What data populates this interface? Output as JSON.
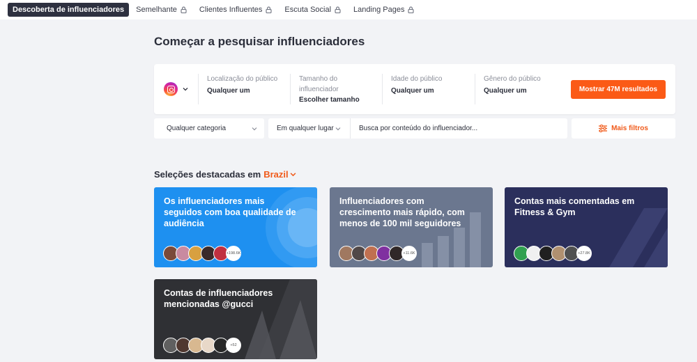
{
  "nav": {
    "tabs": [
      {
        "label": "Descoberta de influenciadores",
        "locked": false,
        "active": true
      },
      {
        "label": "Semelhante",
        "locked": true,
        "active": false
      },
      {
        "label": "Clientes Influentes",
        "locked": true,
        "active": false
      },
      {
        "label": "Escuta Social",
        "locked": true,
        "active": false
      },
      {
        "label": "Landing Pages",
        "locked": true,
        "active": false
      }
    ]
  },
  "page_title": "Começar a pesquisar influenciadores",
  "filters": {
    "platform_icon": "instagram-icon",
    "location": {
      "label": "Localização do público",
      "value": "Qualquer um"
    },
    "size": {
      "label_line1": "Tamanho do",
      "label_line2": "influenciador",
      "value": "Escolher tamanho"
    },
    "age": {
      "label": "Idade do público",
      "value": "Qualquer um"
    },
    "gender": {
      "label": "Gênero do público",
      "value": "Qualquer um"
    },
    "show_button": "Mostrar 47M resultados"
  },
  "search": {
    "category": "Qualquer categoria",
    "place": "Em qualquer lugar",
    "content_placeholder": "Busca por conteúdo do influenciador...",
    "more_filters": "Mais filtros"
  },
  "featured": {
    "title": "Seleções destacadas em",
    "country": "Brazil"
  },
  "cards": [
    {
      "title": "Os influenciadores mais seguidos com boa qualidade de audiência",
      "count": "+198.6K",
      "color": "#1e90f0"
    },
    {
      "title": "Influenciadores com crescimento mais rápido, com menos de 100 mil seguidores",
      "count": "+11.6K",
      "color": "#6b778f"
    },
    {
      "title": "Contas mais comentadas em Fitness & Gym",
      "count": "+27.8K",
      "color": "#2b2f5c"
    },
    {
      "title": "Contas de influenciadores mencionadas @gucci",
      "count": "+52",
      "color": "#2f3034"
    }
  ],
  "colors": {
    "accent": "#fb5a16",
    "nav_active": "#2e3140"
  }
}
